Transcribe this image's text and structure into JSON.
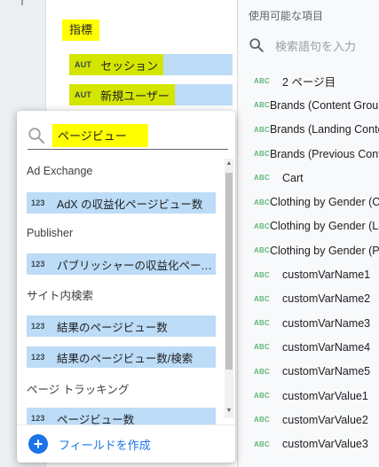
{
  "metrics_panel": {
    "heading": "指標",
    "chips": [
      {
        "type": "AUT",
        "label": "セッション"
      },
      {
        "type": "AUT",
        "label": "新規ユーザー"
      }
    ]
  },
  "available_fields": {
    "title": "使用可能な項目",
    "search_placeholder": "検索語句を入力",
    "type_label": "ABC",
    "items": [
      "2 ページ目",
      "Brands (Content Group)",
      "Brands (Landing Content Group)",
      "Brands (Previous Content Group)",
      "Cart",
      "Clothing by Gender (Content Group)",
      "Clothing by Gender (Landing Content Group)",
      "Clothing by Gender (Previous Content Group)",
      "customVarName1",
      "customVarName2",
      "customVarName3",
      "customVarName4",
      "customVarName5",
      "customVarValue1",
      "customVarValue2",
      "customVarValue3"
    ]
  },
  "field_picker": {
    "search_value": "ページビュー",
    "type_label": "123",
    "groups": [
      {
        "name": "Ad Exchange",
        "items": [
          "AdX の収益化ページビュー数"
        ]
      },
      {
        "name": "Publisher",
        "items": [
          "パブリッシャーの収益化ページビュー数"
        ]
      },
      {
        "name": "サイト内検索",
        "items": [
          "結果のページビュー数",
          "結果のページビュー数/検索"
        ]
      },
      {
        "name": "ページ トラッキング",
        "items": [
          "ページビュー数"
        ]
      }
    ],
    "create_field_label": "フィールドを作成"
  },
  "colors": {
    "highlight": "#ffff00",
    "chip": "#bcdcf7",
    "accent": "#1a73e8",
    "dimension_type": "#5fb878"
  }
}
